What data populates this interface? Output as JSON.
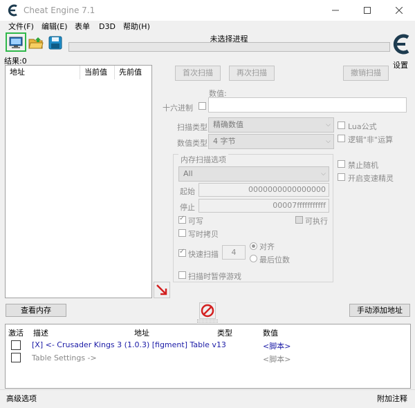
{
  "app": {
    "title": "Cheat Engine 7.1"
  },
  "menu": [
    {
      "label": "文件(F)"
    },
    {
      "label": "编辑(E)"
    },
    {
      "label": "表单"
    },
    {
      "label": "D3D"
    },
    {
      "label": "帮助(H)"
    }
  ],
  "process": {
    "label": "未选择进程",
    "progress": 0
  },
  "settings": {
    "label": "设置"
  },
  "results": {
    "label": "结果:0"
  },
  "found_list": {
    "columns": [
      "地址",
      "当前值",
      "先前值"
    ]
  },
  "scan": {
    "first_scan": "首次扫描",
    "next_scan": "再次扫描",
    "undo_scan": "撤销扫描",
    "value_label": "数值:",
    "hex_label": "十六进制",
    "scan_type_label": "扫描类型",
    "scan_type_value": "精确数值",
    "value_type_label": "数值类型",
    "value_type_value": "4 字节",
    "lua_formula": "Lua公式",
    "not_logic": "逻辑\"非\"运算",
    "disable_random": "禁止随机",
    "speedhack": "开启变速精灵"
  },
  "memory_options": {
    "title": "内存扫描选项",
    "region": "All",
    "start_label": "起始",
    "start_value": "0000000000000000",
    "stop_label": "停止",
    "stop_value": "00007fffffffffff",
    "writable": "可写",
    "executable": "可执行",
    "copy_on_write": "写时拷贝",
    "fast_scan": "快速扫描",
    "fast_scan_value": "4",
    "align": "对齐",
    "last_digits": "最后位数",
    "pause_game": "扫描时暂停游戏"
  },
  "buttons": {
    "view_memory": "查看内存",
    "add_address": "手动添加地址"
  },
  "cheat_table": {
    "columns": [
      "激活",
      "描述",
      "地址",
      "类型",
      "数值"
    ],
    "rows": [
      {
        "description": "[X] <- Crusader Kings 3 (1.0.3) [figment] Table v13",
        "value": "<脚本>"
      },
      {
        "description": "Table Settings ->",
        "value": "<脚本>"
      }
    ]
  },
  "statusbar": {
    "left": "高级选项",
    "right": "附加注释"
  },
  "colors": {
    "highlight": "#2fb84a",
    "link_blue": "#1a1aa6",
    "stop_red": "#d32020"
  }
}
